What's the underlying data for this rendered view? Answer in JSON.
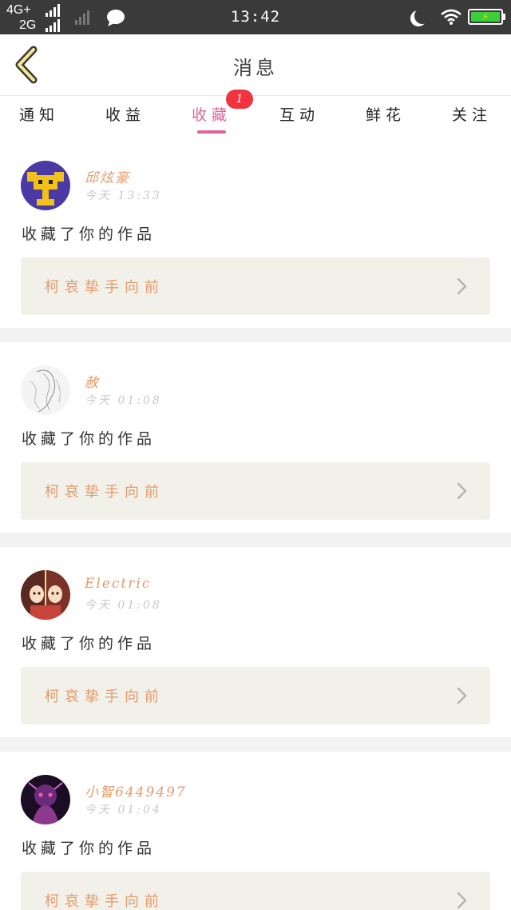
{
  "status_bar": {
    "network_top": "4G+",
    "network_bottom": "2G",
    "time": "13:42",
    "battery_charging_symbol": "⚡"
  },
  "header": {
    "title": "消息",
    "back_icon": "chevron-left-icon"
  },
  "tabs": [
    {
      "label": "通知",
      "active": false
    },
    {
      "label": "收益",
      "active": false
    },
    {
      "label": "收藏",
      "active": true,
      "badge": "1"
    },
    {
      "label": "互动",
      "active": false
    },
    {
      "label": "鲜花",
      "active": false
    },
    {
      "label": "关注",
      "active": false
    }
  ],
  "messages": [
    {
      "username": "邱炫豪",
      "time": "今天 13:33",
      "action": "收藏了你的作品",
      "work_title": "柯哀挚手向前"
    },
    {
      "username": "赦",
      "time": "今天 01:08",
      "action": "收藏了你的作品",
      "work_title": "柯哀挚手向前"
    },
    {
      "username": "Electric",
      "time": "今天 01:08",
      "action": "收藏了你的作品",
      "work_title": "柯哀挚手向前"
    },
    {
      "username": "小智6449497",
      "time": "今天 01:04",
      "action": "收藏了你的作品",
      "work_title": "柯哀挚手向前"
    }
  ],
  "colors": {
    "accent": "#e0649a",
    "badge": "#f0333d",
    "username": "#e69a6a",
    "work_box_bg": "#f1f1ea",
    "status_bar_bg": "#3a3a3a"
  }
}
